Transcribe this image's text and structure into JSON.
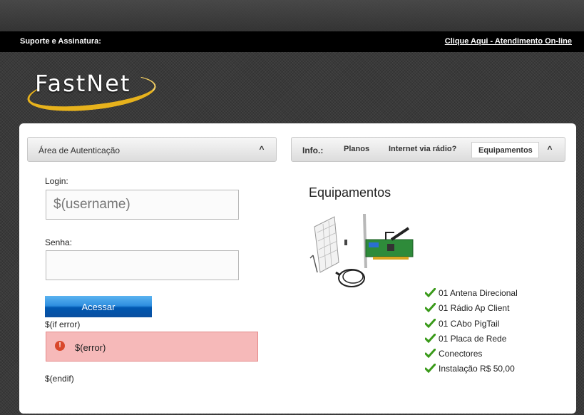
{
  "topbar": {
    "support_label": "Suporte e Assinatura:",
    "online_link": "Clique Aqui - Atendimento On-line"
  },
  "logo": {
    "text": "FastNet"
  },
  "auth": {
    "title": "Área de Autenticação",
    "login_label": "Login:",
    "login_value": "$(username)",
    "password_label": "Senha:",
    "submit_label": "Acessar",
    "if_error": "$(if error)",
    "error_text": "$(error)",
    "endif": "$(endif)"
  },
  "info": {
    "label": "Info.:",
    "tabs": [
      "Planos",
      "Internet via rádio?",
      "Equipamentos"
    ],
    "active_tab": "Equipamentos",
    "section_title": "Equipamentos",
    "items": [
      "01 Antena Direcional",
      "01 Rádio Ap Client",
      "01 CAbo PigTail",
      "01 Placa de Rede",
      "Conectores",
      "Instalação R$ 50,00"
    ]
  },
  "colors": {
    "accent_yellow": "#e7b21c",
    "button_blue": "#0058b0",
    "error_bg": "#f6b9b9",
    "check_green": "#3a9a1a"
  }
}
